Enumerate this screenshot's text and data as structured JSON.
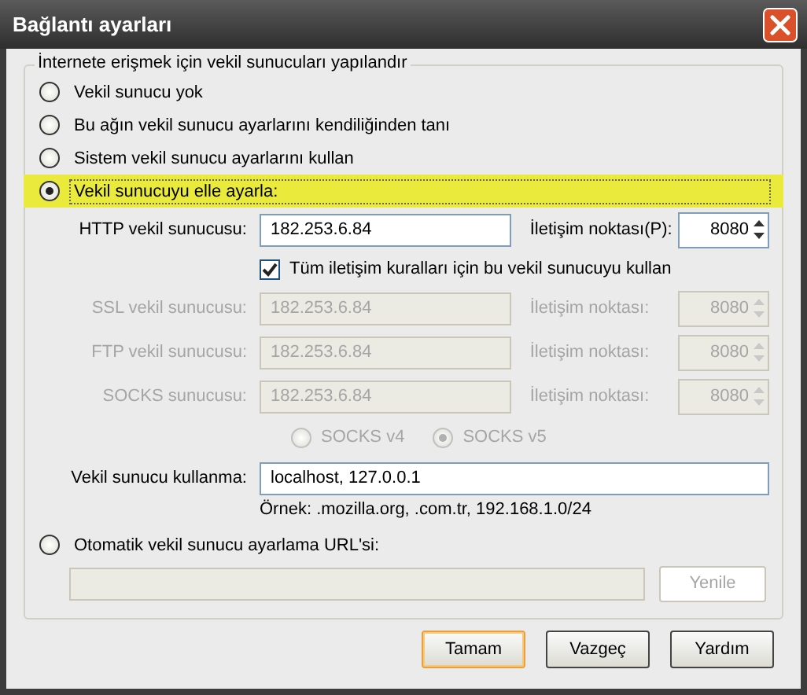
{
  "window": {
    "title": "Bağlantı ayarları"
  },
  "group": {
    "legend": "İnternete erişmek için vekil sunucuları yapılandır"
  },
  "modes": [
    {
      "label": "Vekil sunucu yok",
      "selected": false,
      "highlighted": false
    },
    {
      "label": "Bu ağın vekil sunucu ayarlarını kendiliğinden tanı",
      "selected": false,
      "highlighted": false
    },
    {
      "label": "Sistem vekil sunucu ayarlarını kullan",
      "selected": false,
      "highlighted": false
    },
    {
      "label": "Vekil sunucuyu elle ayarla:",
      "selected": true,
      "highlighted": true
    }
  ],
  "proxies": [
    {
      "label": "HTTP vekil sunucusu:",
      "value": "182.253.6.84",
      "port_label": "İletişim noktası(P):",
      "port": "8080",
      "disabled": false
    },
    {
      "label": "SSL vekil sunucusu:",
      "value": "182.253.6.84",
      "port_label": "İletişim noktası:",
      "port": "8080",
      "disabled": true
    },
    {
      "label": "FTP vekil sunucusu:",
      "value": "182.253.6.84",
      "port_label": "İletişim noktası:",
      "port": "8080",
      "disabled": true
    },
    {
      "label": "SOCKS sunucusu:",
      "value": "182.253.6.84",
      "port_label": "İletişim noktası:",
      "port": "8080",
      "disabled": true
    }
  ],
  "share_checkbox": {
    "label": "Tüm iletişim kuralları için bu vekil sunucuyu kullan",
    "checked": true
  },
  "socks_versions": [
    {
      "label": "SOCKS v4",
      "selected": false,
      "disabled": true
    },
    {
      "label": "SOCKS v5",
      "selected": true,
      "disabled": true
    }
  ],
  "no_proxy": {
    "label": "Vekil sunucu kullanma:",
    "value": "localhost, 127.0.0.1",
    "example": "Örnek: .mozilla.org, .com.tr, 192.168.1.0/24"
  },
  "auto": {
    "label": "Otomatik vekil sunucu ayarlama URL'si:",
    "selected": false,
    "url_disabled": true,
    "reload": {
      "label": "Yenile",
      "disabled": true
    }
  },
  "buttons": [
    {
      "label": "Tamam",
      "default": true
    },
    {
      "label": "Vazgeç",
      "default": false
    },
    {
      "label": "Yardım",
      "default": false
    }
  ]
}
